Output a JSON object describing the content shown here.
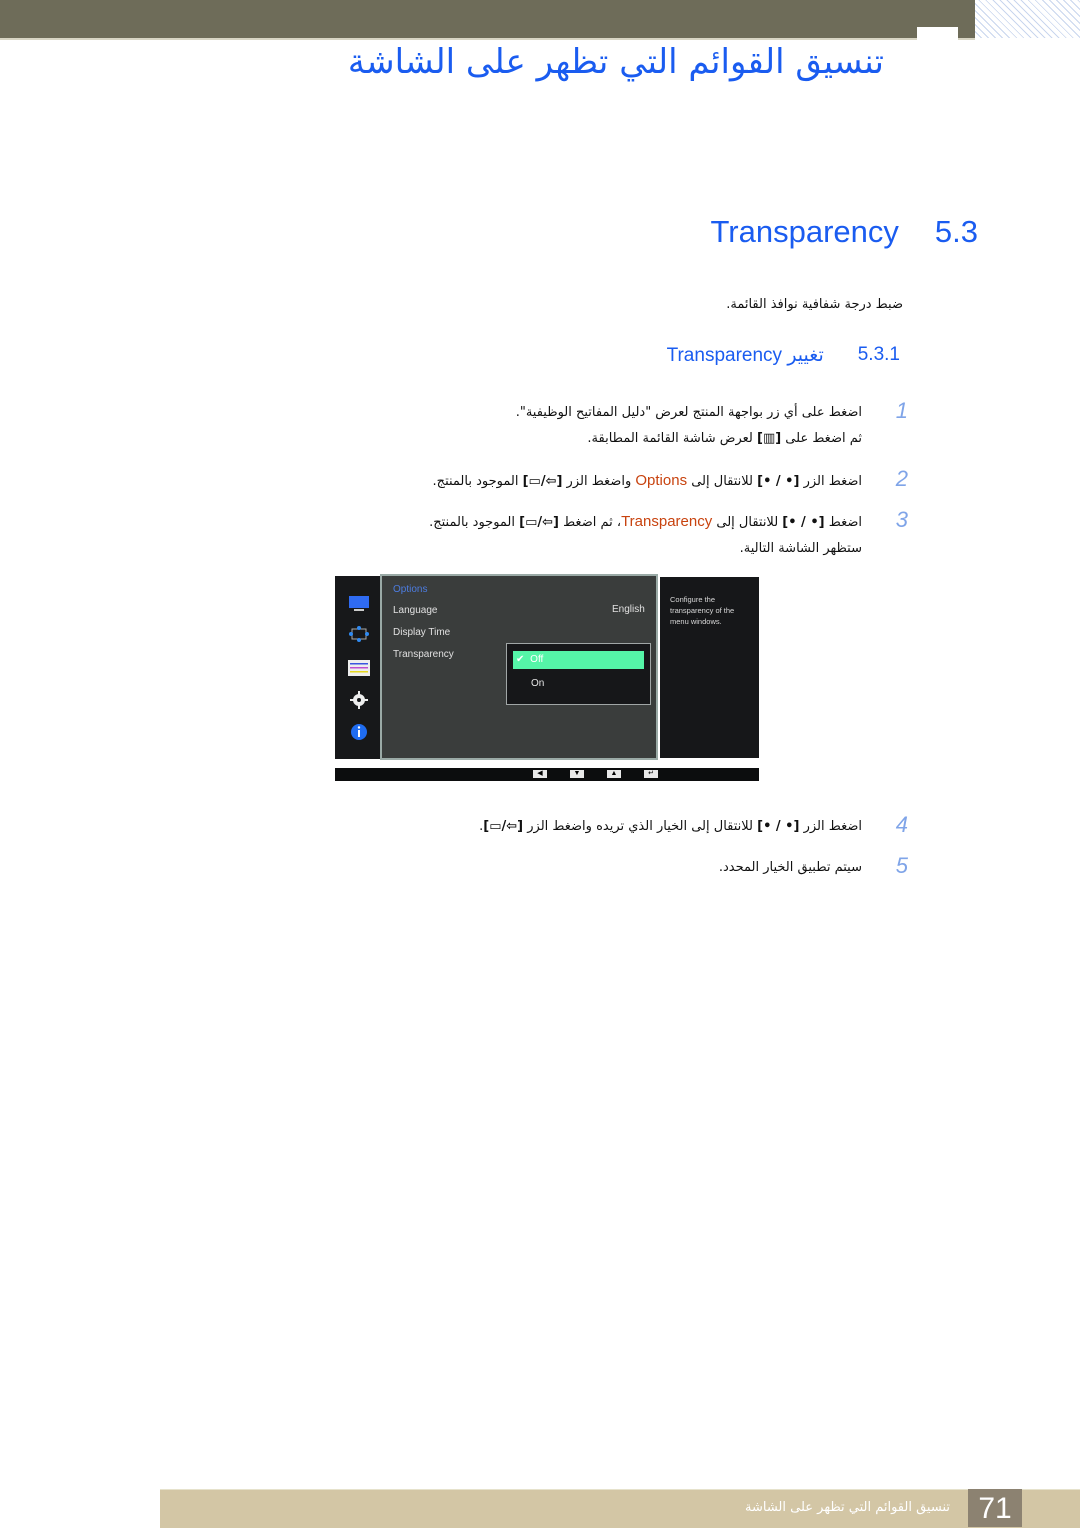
{
  "header": {
    "chapter_title": "تنسيق القوائم التي تظهر على الشاشة"
  },
  "section": {
    "number": "5.3",
    "title": "Transparency",
    "intro": "ضبط درجة شفافية نوافذ القائمة."
  },
  "subsection": {
    "number": "5.3.1",
    "title": "تغيير Transparency"
  },
  "steps": [
    {
      "num": "1",
      "line1": "اضغط على أي زر بواجهة المنتج لعرض \"دليل المفاتيح الوظيفية\".",
      "line2_a": "ثم اضغط على ",
      "line2_btn": "[▥]",
      "line2_b": " لعرض شاشة القائمة المطابقة."
    },
    {
      "num": "2",
      "a": "اضغط الزر ",
      "btn1": "[• / •]",
      "b": " للانتقال إلى ",
      "highlight": "Options",
      "c": " واضغط الزر ",
      "btn2": "[⇦/▭]",
      "d": " الموجود بالمنتج."
    },
    {
      "num": "3",
      "a": "اضغط ",
      "btn1": "[• / •]",
      "b": " للانتقال إلى ",
      "highlight": "Transparency",
      "c": "، ثم اضغط ",
      "btn2": "[⇦/▭]",
      "d": " الموجود بالمنتج.",
      "line2": "ستظهر الشاشة التالية."
    },
    {
      "num": "4",
      "a": "اضغط الزر ",
      "btn1": "[• / •]",
      "b": " للانتقال إلى الخيار الذي تريده واضغط الزر ",
      "btn2": "[⇦/▭]",
      "d": "."
    },
    {
      "num": "5",
      "a": "سيتم تطبيق الخيار المحدد."
    }
  ],
  "osd": {
    "header": "Options",
    "items": [
      "Language",
      "Display Time",
      "Transparency"
    ],
    "language_value": "English",
    "dropdown": {
      "selected": "Off",
      "other": "On"
    },
    "help": "Configure the transparency of the menu windows.",
    "nav_buttons": [
      "◀",
      "▼",
      "▲",
      "↵"
    ],
    "colors": {
      "selected": "#55f5a8",
      "header": "#4c7ce0"
    }
  },
  "footer": {
    "page_number": "71",
    "title": "تنسيق القوائم التي تظهر على الشاشة"
  },
  "colors": {
    "accent": "#1a5cf0",
    "highlight": "#c8430f",
    "footer": "#d3c6a5"
  }
}
